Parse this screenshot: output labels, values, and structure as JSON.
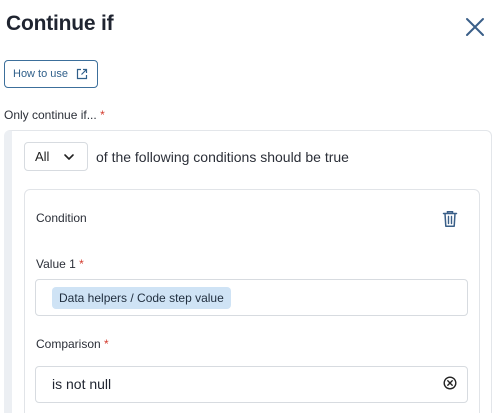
{
  "header": {
    "title": "Continue if",
    "close_icon": "close-icon"
  },
  "help": {
    "label": "How to use",
    "icon": "external-link-icon"
  },
  "section": {
    "label": "Only continue if...",
    "required_marker": "*"
  },
  "mode": {
    "selected": "All",
    "suffix_text": "of the following conditions should be true"
  },
  "condition": {
    "title": "Condition",
    "delete_icon": "trash-icon",
    "value1": {
      "label": "Value 1",
      "required_marker": "*",
      "token": "Data helpers / Code step value"
    },
    "comparison": {
      "label": "Comparison",
      "required_marker": "*",
      "value": "is not null",
      "clear_icon": "clear-circle-icon"
    }
  },
  "colors": {
    "accent": "#2f5f8a",
    "required": "#d33a2c",
    "token_bg": "#cfe3f5"
  }
}
